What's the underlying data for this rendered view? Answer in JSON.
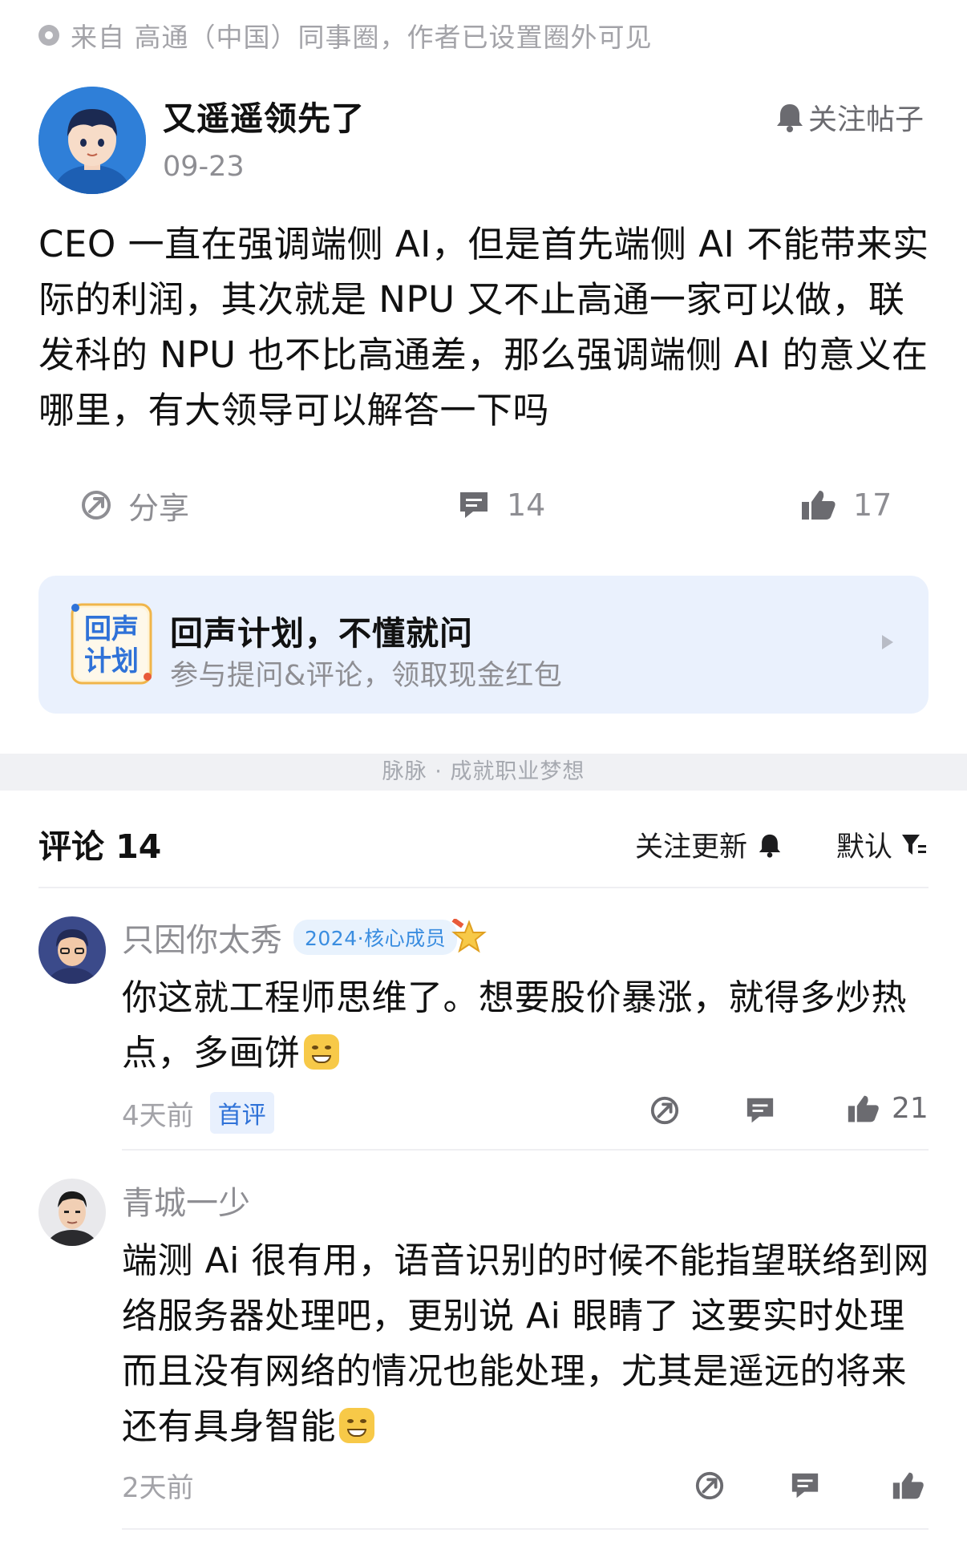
{
  "source": {
    "text": "来自 高通（中国）同事圈，作者已设置圈外可见"
  },
  "post": {
    "author": "又遥遥领先了",
    "date": "09-23",
    "follow_label": "关注帖子",
    "body": "CEO 一直在强调端侧 AI，但是首先端侧 AI 不能带来实际的利润，其次就是 NPU 又不止高通一家可以做，联发科的 NPU 也不比高通差，那么强调端侧 AI 的意义在哪里，有大领导可以解答一下吗",
    "actions": {
      "share_label": "分享",
      "comment_count": "14",
      "like_count": "17"
    }
  },
  "promo": {
    "icon_text_1": "回声",
    "icon_text_2": "计划",
    "title": "回声计划，不懂就问",
    "subtitle": "参与提问&评论，领取现金红包"
  },
  "band": {
    "text": "脉脉 · 成就职业梦想"
  },
  "comments_header": {
    "title": "评论 14",
    "follow_label": "关注更新",
    "sort_label": "默认"
  },
  "comments": [
    {
      "author": "只因你太秀",
      "badge": "2024·核心成员",
      "text": "你这就工程师思维了。想要股价暴涨，就得多炒热点，多画饼",
      "time": "4天前",
      "tag": "首评",
      "like_count": "21"
    },
    {
      "author": "青城一少",
      "text": "端测 Ai 很有用，语音识别的时候不能指望联络到网络服务器处理吧，更别说 Ai 眼睛了 这要实时处理而且没有网络的情况也能处理，尤其是遥远的将来还有具身智能",
      "time": "2天前"
    }
  ],
  "colors": {
    "accent_blue": "#2f72d8",
    "promo_bg": "#eaf1fd",
    "muted_text": "#8e8e93"
  }
}
